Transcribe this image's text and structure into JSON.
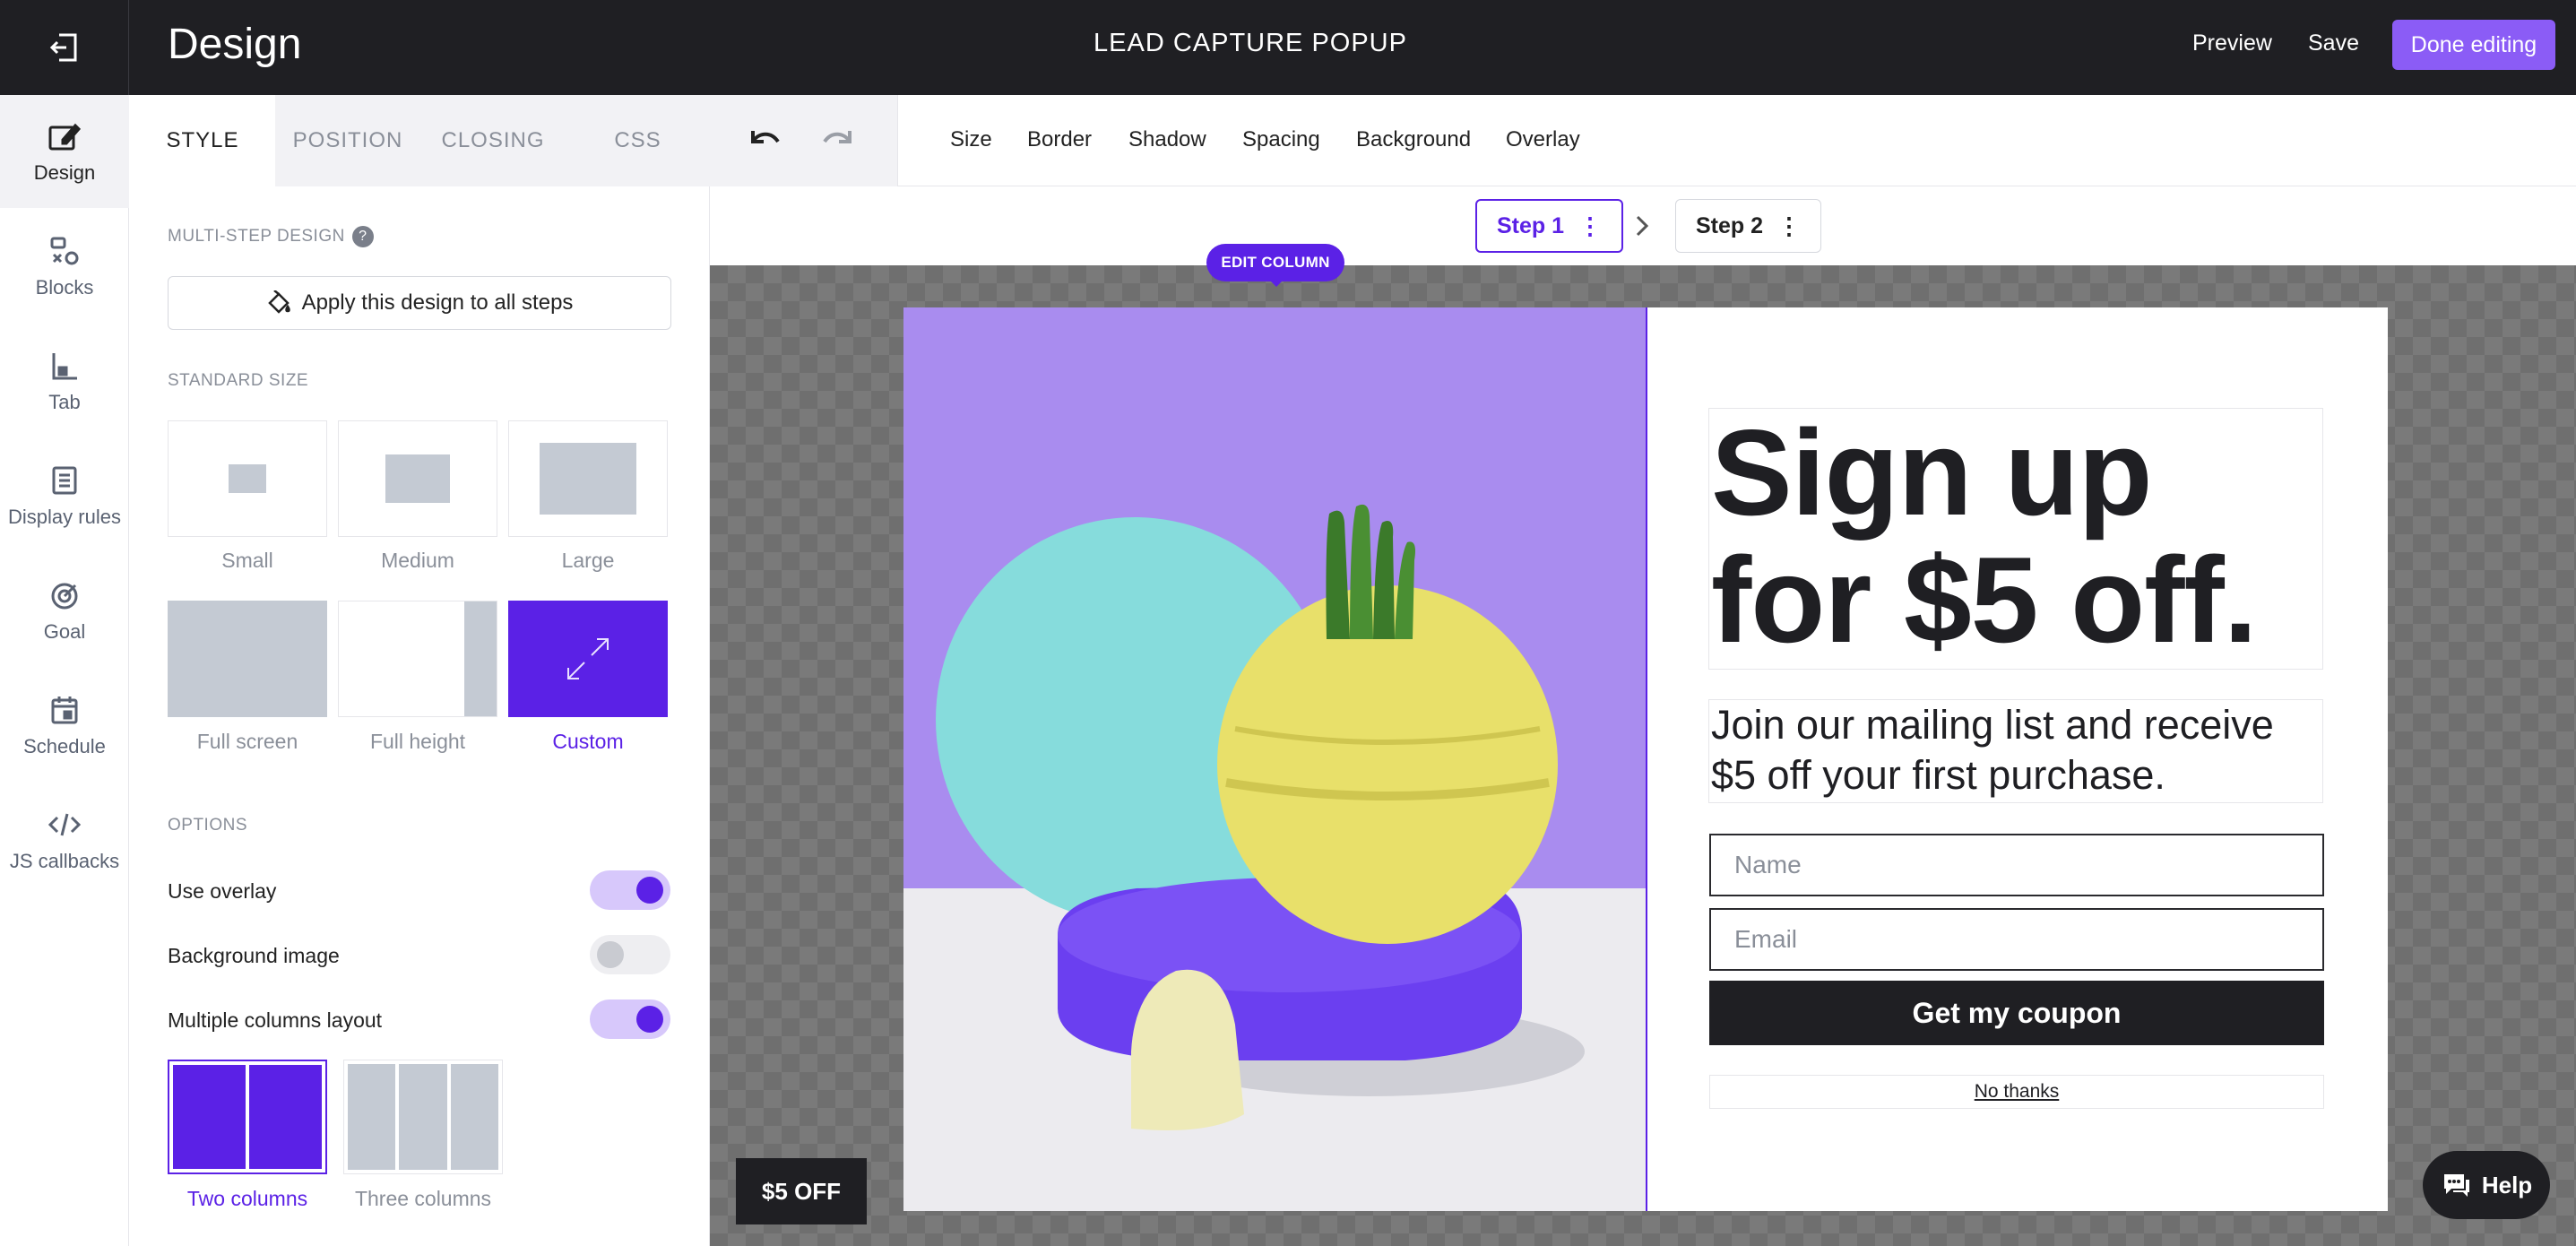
{
  "topbar": {
    "title": "Design",
    "center_title": "LEAD CAPTURE POPUP",
    "preview": "Preview",
    "save": "Save",
    "done": "Done editing"
  },
  "nav": [
    {
      "label": "Design",
      "icon": "pen-icon"
    },
    {
      "label": "Blocks",
      "icon": "blocks-icon"
    },
    {
      "label": "Tab",
      "icon": "tab-icon"
    },
    {
      "label": "Display rules",
      "icon": "document-icon"
    },
    {
      "label": "Goal",
      "icon": "target-icon"
    },
    {
      "label": "Schedule",
      "icon": "calendar-icon"
    },
    {
      "label": "JS callbacks",
      "icon": "code-icon"
    }
  ],
  "panel": {
    "tabs": [
      "STYLE",
      "POSITION",
      "CLOSING",
      "CSS"
    ],
    "multistep_label": "MULTI-STEP DESIGN",
    "help": "?",
    "apply_label": "Apply this design to all steps",
    "standard_size_label": "STANDARD SIZE",
    "sizes": [
      "Small",
      "Medium",
      "Large",
      "Full screen",
      "Full height",
      "Custom"
    ],
    "options_label": "OPTIONS",
    "options": [
      {
        "label": "Use overlay",
        "on": true
      },
      {
        "label": "Background image",
        "on": false
      },
      {
        "label": "Multiple columns layout",
        "on": true
      }
    ],
    "columns": [
      "Two columns",
      "Three columns"
    ]
  },
  "toolbar": {
    "items": [
      "Size",
      "Border",
      "Shadow",
      "Spacing",
      "Background",
      "Overlay"
    ]
  },
  "steps": [
    "Step 1",
    "Step 2"
  ],
  "popup": {
    "edit_column": "EDIT COLUMN",
    "headline": "Sign up for $5 off.",
    "subtext": "Join our mailing list and receive $5 off your first purchase.",
    "name_placeholder": "Name",
    "email_placeholder": "Email",
    "cta": "Get my coupon",
    "no_thanks": "No thanks",
    "teaser": "$5 OFF"
  },
  "help_label": "Help",
  "colors": {
    "accent": "#5b21e6",
    "accent_light": "#8b5cf6",
    "dark": "#1f1f23"
  }
}
